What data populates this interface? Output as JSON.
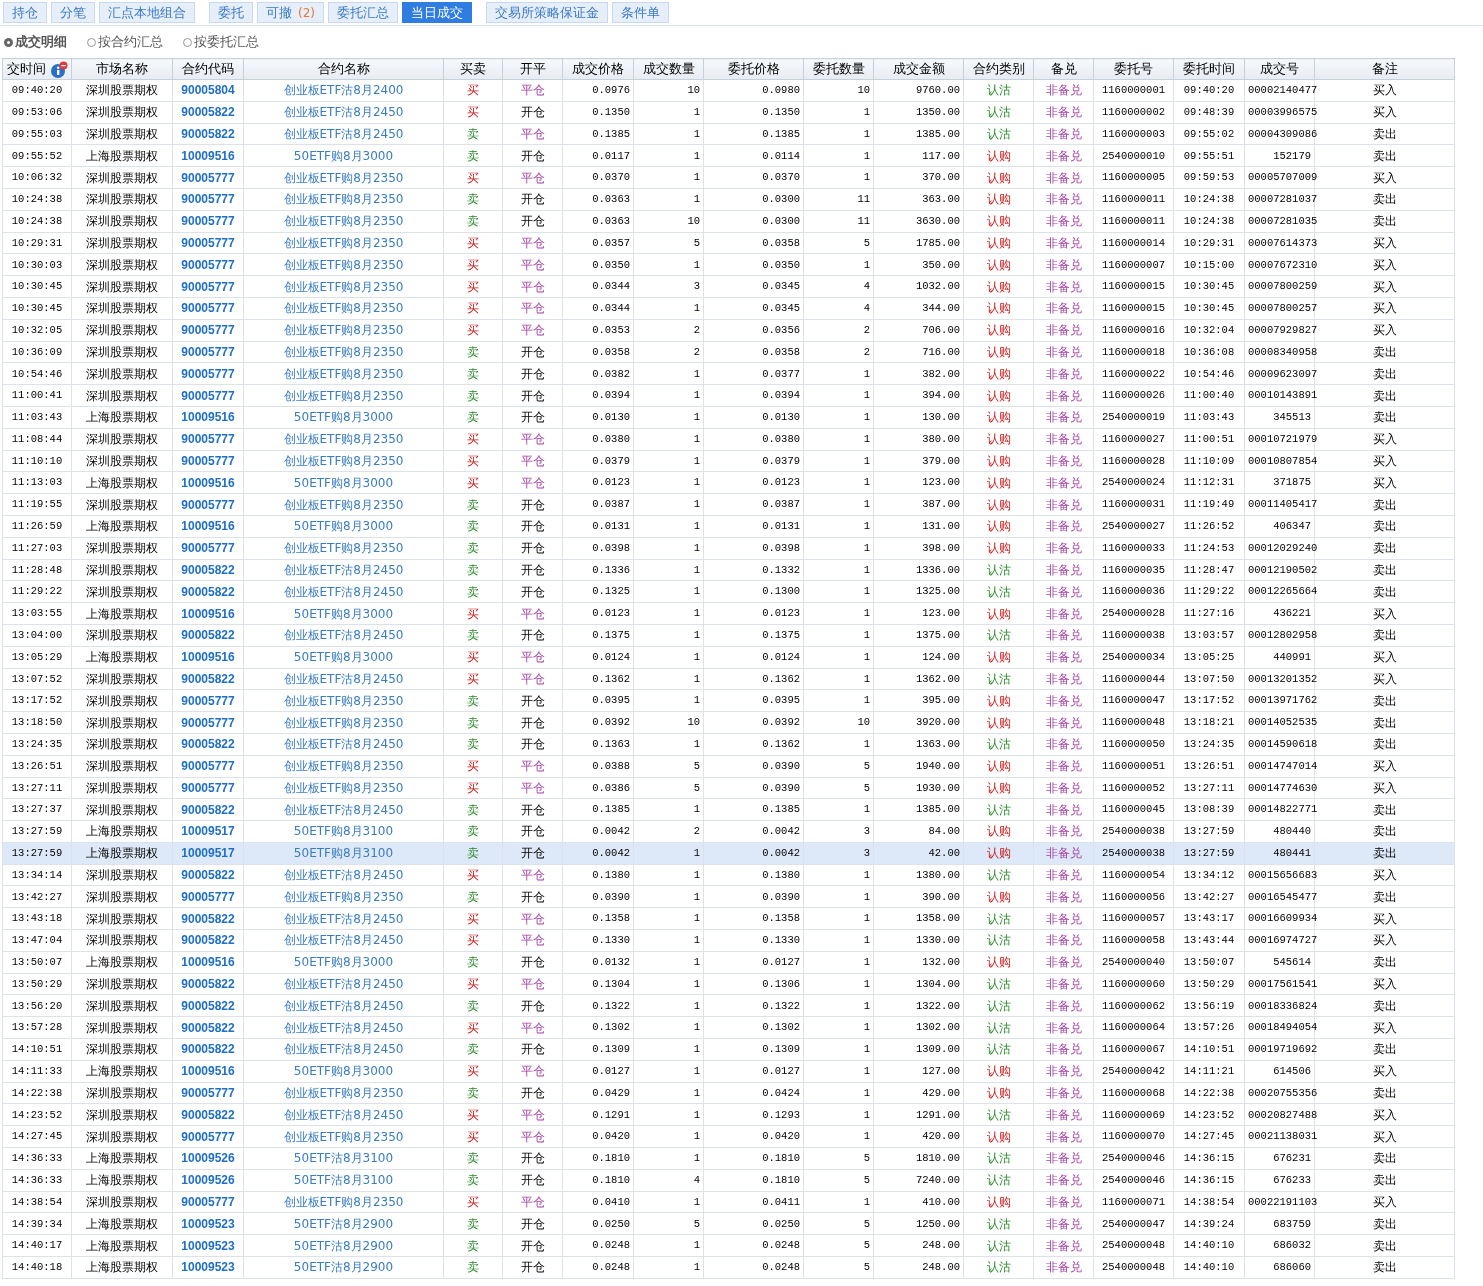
{
  "tab_groups": [
    [
      {
        "label": "持仓",
        "selected": false
      },
      {
        "label": "分笔",
        "selected": false
      },
      {
        "label": "汇点本地组合",
        "selected": false
      }
    ],
    [
      {
        "label": "委托",
        "selected": false
      },
      {
        "label": "可撤",
        "count": "(2)",
        "selected": false
      },
      {
        "label": "委托汇总",
        "selected": false
      },
      {
        "label": "当日成交",
        "selected": true
      }
    ],
    [
      {
        "label": "交易所策略保证金",
        "selected": false
      },
      {
        "label": "条件单",
        "selected": false
      }
    ]
  ],
  "view_options": [
    {
      "label": "成交明细",
      "selected": true
    },
    {
      "label": "按合约汇总",
      "selected": false
    },
    {
      "label": "按委托汇总",
      "selected": false
    }
  ],
  "table": {
    "columns": [
      "交时间",
      "市场名称",
      "合约代码",
      "合约名称",
      "买卖",
      "开平",
      "成交价格",
      "成交数量",
      "委托价格",
      "委托数量",
      "成交金额",
      "合约类别",
      "备兑",
      "委托号",
      "委托时间",
      "成交号",
      "备注"
    ],
    "rows": [
      {
        "selected": false,
        "cells": [
          "09:40:20",
          "深圳股票期权",
          "90005804",
          "创业板ETF沽8月2400",
          {
            "text": "买",
            "kind": "buy"
          },
          {
            "text": "平仓",
            "kind": "close"
          },
          "0.0976",
          "10",
          "0.0980",
          "10",
          "9760.00",
          {
            "text": "认沽",
            "kind": "put"
          },
          "非备兑",
          "1160000001",
          "09:40:20",
          "00002140477",
          "买入"
        ]
      },
      {
        "selected": false,
        "cells": [
          "09:53:06",
          "深圳股票期权",
          "90005822",
          "创业板ETF沽8月2450",
          {
            "text": "买",
            "kind": "buy"
          },
          {
            "text": "开仓",
            "kind": "open"
          },
          "0.1350",
          "1",
          "0.1350",
          "1",
          "1350.00",
          {
            "text": "认沽",
            "kind": "put"
          },
          "非备兑",
          "1160000002",
          "09:48:39",
          "00003996575",
          "买入"
        ]
      },
      {
        "selected": false,
        "cells": [
          "09:55:03",
          "深圳股票期权",
          "90005822",
          "创业板ETF沽8月2450",
          {
            "text": "卖",
            "kind": "sell"
          },
          {
            "text": "平仓",
            "kind": "close"
          },
          "0.1385",
          "1",
          "0.1385",
          "1",
          "1385.00",
          {
            "text": "认沽",
            "kind": "put"
          },
          "非备兑",
          "1160000003",
          "09:55:02",
          "00004309086",
          "卖出"
        ]
      },
      {
        "selected": false,
        "cells": [
          "09:55:52",
          "上海股票期权",
          "10009516",
          "50ETF购8月3000",
          {
            "text": "卖",
            "kind": "sell"
          },
          {
            "text": "开仓",
            "kind": "open"
          },
          "0.0117",
          "1",
          "0.0114",
          "1",
          "117.00",
          {
            "text": "认购",
            "kind": "call"
          },
          "非备兑",
          "2540000010",
          "09:55:51",
          "152179",
          "卖出"
        ]
      },
      {
        "selected": false,
        "cells": [
          "10:06:32",
          "深圳股票期权",
          "90005777",
          "创业板ETF购8月2350",
          {
            "text": "买",
            "kind": "buy"
          },
          {
            "text": "平仓",
            "kind": "close"
          },
          "0.0370",
          "1",
          "0.0370",
          "1",
          "370.00",
          {
            "text": "认购",
            "kind": "call"
          },
          "非备兑",
          "1160000005",
          "09:59:53",
          "00005707009",
          "买入"
        ]
      },
      {
        "selected": false,
        "cells": [
          "10:24:38",
          "深圳股票期权",
          "90005777",
          "创业板ETF购8月2350",
          {
            "text": "卖",
            "kind": "sell"
          },
          {
            "text": "开仓",
            "kind": "open"
          },
          "0.0363",
          "1",
          "0.0300",
          "11",
          "363.00",
          {
            "text": "认购",
            "kind": "call"
          },
          "非备兑",
          "1160000011",
          "10:24:38",
          "00007281037",
          "卖出"
        ]
      },
      {
        "selected": false,
        "cells": [
          "10:24:38",
          "深圳股票期权",
          "90005777",
          "创业板ETF购8月2350",
          {
            "text": "卖",
            "kind": "sell"
          },
          {
            "text": "开仓",
            "kind": "open"
          },
          "0.0363",
          "10",
          "0.0300",
          "11",
          "3630.00",
          {
            "text": "认购",
            "kind": "call"
          },
          "非备兑",
          "1160000011",
          "10:24:38",
          "00007281035",
          "卖出"
        ]
      },
      {
        "selected": false,
        "cells": [
          "10:29:31",
          "深圳股票期权",
          "90005777",
          "创业板ETF购8月2350",
          {
            "text": "买",
            "kind": "buy"
          },
          {
            "text": "平仓",
            "kind": "close"
          },
          "0.0357",
          "5",
          "0.0358",
          "5",
          "1785.00",
          {
            "text": "认购",
            "kind": "call"
          },
          "非备兑",
          "1160000014",
          "10:29:31",
          "00007614373",
          "买入"
        ]
      },
      {
        "selected": false,
        "cells": [
          "10:30:03",
          "深圳股票期权",
          "90005777",
          "创业板ETF购8月2350",
          {
            "text": "买",
            "kind": "buy"
          },
          {
            "text": "平仓",
            "kind": "close"
          },
          "0.0350",
          "1",
          "0.0350",
          "1",
          "350.00",
          {
            "text": "认购",
            "kind": "call"
          },
          "非备兑",
          "1160000007",
          "10:15:00",
          "00007672310",
          "买入"
        ]
      },
      {
        "selected": false,
        "cells": [
          "10:30:45",
          "深圳股票期权",
          "90005777",
          "创业板ETF购8月2350",
          {
            "text": "买",
            "kind": "buy"
          },
          {
            "text": "平仓",
            "kind": "close"
          },
          "0.0344",
          "3",
          "0.0345",
          "4",
          "1032.00",
          {
            "text": "认购",
            "kind": "call"
          },
          "非备兑",
          "1160000015",
          "10:30:45",
          "00007800259",
          "买入"
        ]
      },
      {
        "selected": false,
        "cells": [
          "10:30:45",
          "深圳股票期权",
          "90005777",
          "创业板ETF购8月2350",
          {
            "text": "买",
            "kind": "buy"
          },
          {
            "text": "平仓",
            "kind": "close"
          },
          "0.0344",
          "1",
          "0.0345",
          "4",
          "344.00",
          {
            "text": "认购",
            "kind": "call"
          },
          "非备兑",
          "1160000015",
          "10:30:45",
          "00007800257",
          "买入"
        ]
      },
      {
        "selected": false,
        "cells": [
          "10:32:05",
          "深圳股票期权",
          "90005777",
          "创业板ETF购8月2350",
          {
            "text": "买",
            "kind": "buy"
          },
          {
            "text": "平仓",
            "kind": "close"
          },
          "0.0353",
          "2",
          "0.0356",
          "2",
          "706.00",
          {
            "text": "认购",
            "kind": "call"
          },
          "非备兑",
          "1160000016",
          "10:32:04",
          "00007929827",
          "买入"
        ]
      },
      {
        "selected": false,
        "cells": [
          "10:36:09",
          "深圳股票期权",
          "90005777",
          "创业板ETF购8月2350",
          {
            "text": "卖",
            "kind": "sell"
          },
          {
            "text": "开仓",
            "kind": "open"
          },
          "0.0358",
          "2",
          "0.0358",
          "2",
          "716.00",
          {
            "text": "认购",
            "kind": "call"
          },
          "非备兑",
          "1160000018",
          "10:36:08",
          "00008340958",
          "卖出"
        ]
      },
      {
        "selected": false,
        "cells": [
          "10:54:46",
          "深圳股票期权",
          "90005777",
          "创业板ETF购8月2350",
          {
            "text": "卖",
            "kind": "sell"
          },
          {
            "text": "开仓",
            "kind": "open"
          },
          "0.0382",
          "1",
          "0.0377",
          "1",
          "382.00",
          {
            "text": "认购",
            "kind": "call"
          },
          "非备兑",
          "1160000022",
          "10:54:46",
          "00009623097",
          "卖出"
        ]
      },
      {
        "selected": false,
        "cells": [
          "11:00:41",
          "深圳股票期权",
          "90005777",
          "创业板ETF购8月2350",
          {
            "text": "卖",
            "kind": "sell"
          },
          {
            "text": "开仓",
            "kind": "open"
          },
          "0.0394",
          "1",
          "0.0394",
          "1",
          "394.00",
          {
            "text": "认购",
            "kind": "call"
          },
          "非备兑",
          "1160000026",
          "11:00:40",
          "00010143891",
          "卖出"
        ]
      },
      {
        "selected": false,
        "cells": [
          "11:03:43",
          "上海股票期权",
          "10009516",
          "50ETF购8月3000",
          {
            "text": "卖",
            "kind": "sell"
          },
          {
            "text": "开仓",
            "kind": "open"
          },
          "0.0130",
          "1",
          "0.0130",
          "1",
          "130.00",
          {
            "text": "认购",
            "kind": "call"
          },
          "非备兑",
          "2540000019",
          "11:03:43",
          "345513",
          "卖出"
        ]
      },
      {
        "selected": false,
        "cells": [
          "11:08:44",
          "深圳股票期权",
          "90005777",
          "创业板ETF购8月2350",
          {
            "text": "买",
            "kind": "buy"
          },
          {
            "text": "平仓",
            "kind": "close"
          },
          "0.0380",
          "1",
          "0.0380",
          "1",
          "380.00",
          {
            "text": "认购",
            "kind": "call"
          },
          "非备兑",
          "1160000027",
          "11:00:51",
          "00010721979",
          "买入"
        ]
      },
      {
        "selected": false,
        "cells": [
          "11:10:10",
          "深圳股票期权",
          "90005777",
          "创业板ETF购8月2350",
          {
            "text": "买",
            "kind": "buy"
          },
          {
            "text": "平仓",
            "kind": "close"
          },
          "0.0379",
          "1",
          "0.0379",
          "1",
          "379.00",
          {
            "text": "认购",
            "kind": "call"
          },
          "非备兑",
          "1160000028",
          "11:10:09",
          "00010807854",
          "买入"
        ]
      },
      {
        "selected": false,
        "cells": [
          "11:13:03",
          "上海股票期权",
          "10009516",
          "50ETF购8月3000",
          {
            "text": "买",
            "kind": "buy"
          },
          {
            "text": "平仓",
            "kind": "close"
          },
          "0.0123",
          "1",
          "0.0123",
          "1",
          "123.00",
          {
            "text": "认购",
            "kind": "call"
          },
          "非备兑",
          "2540000024",
          "11:12:31",
          "371875",
          "买入"
        ]
      },
      {
        "selected": false,
        "cells": [
          "11:19:55",
          "深圳股票期权",
          "90005777",
          "创业板ETF购8月2350",
          {
            "text": "卖",
            "kind": "sell"
          },
          {
            "text": "开仓",
            "kind": "open"
          },
          "0.0387",
          "1",
          "0.0387",
          "1",
          "387.00",
          {
            "text": "认购",
            "kind": "call"
          },
          "非备兑",
          "1160000031",
          "11:19:49",
          "00011405417",
          "卖出"
        ]
      },
      {
        "selected": false,
        "cells": [
          "11:26:59",
          "上海股票期权",
          "10009516",
          "50ETF购8月3000",
          {
            "text": "卖",
            "kind": "sell"
          },
          {
            "text": "开仓",
            "kind": "open"
          },
          "0.0131",
          "1",
          "0.0131",
          "1",
          "131.00",
          {
            "text": "认购",
            "kind": "call"
          },
          "非备兑",
          "2540000027",
          "11:26:52",
          "406347",
          "卖出"
        ]
      },
      {
        "selected": false,
        "cells": [
          "11:27:03",
          "深圳股票期权",
          "90005777",
          "创业板ETF购8月2350",
          {
            "text": "卖",
            "kind": "sell"
          },
          {
            "text": "开仓",
            "kind": "open"
          },
          "0.0398",
          "1",
          "0.0398",
          "1",
          "398.00",
          {
            "text": "认购",
            "kind": "call"
          },
          "非备兑",
          "1160000033",
          "11:24:53",
          "00012029240",
          "卖出"
        ]
      },
      {
        "selected": false,
        "cells": [
          "11:28:48",
          "深圳股票期权",
          "90005822",
          "创业板ETF沽8月2450",
          {
            "text": "卖",
            "kind": "sell"
          },
          {
            "text": "开仓",
            "kind": "open"
          },
          "0.1336",
          "1",
          "0.1332",
          "1",
          "1336.00",
          {
            "text": "认沽",
            "kind": "put"
          },
          "非备兑",
          "1160000035",
          "11:28:47",
          "00012190502",
          "卖出"
        ]
      },
      {
        "selected": false,
        "cells": [
          "11:29:22",
          "深圳股票期权",
          "90005822",
          "创业板ETF沽8月2450",
          {
            "text": "卖",
            "kind": "sell"
          },
          {
            "text": "开仓",
            "kind": "open"
          },
          "0.1325",
          "1",
          "0.1300",
          "1",
          "1325.00",
          {
            "text": "认沽",
            "kind": "put"
          },
          "非备兑",
          "1160000036",
          "11:29:22",
          "00012265664",
          "卖出"
        ]
      },
      {
        "selected": false,
        "cells": [
          "13:03:55",
          "上海股票期权",
          "10009516",
          "50ETF购8月3000",
          {
            "text": "买",
            "kind": "buy"
          },
          {
            "text": "平仓",
            "kind": "close"
          },
          "0.0123",
          "1",
          "0.0123",
          "1",
          "123.00",
          {
            "text": "认购",
            "kind": "call"
          },
          "非备兑",
          "2540000028",
          "11:27:16",
          "436221",
          "买入"
        ]
      },
      {
        "selected": false,
        "cells": [
          "13:04:00",
          "深圳股票期权",
          "90005822",
          "创业板ETF沽8月2450",
          {
            "text": "卖",
            "kind": "sell"
          },
          {
            "text": "开仓",
            "kind": "open"
          },
          "0.1375",
          "1",
          "0.1375",
          "1",
          "1375.00",
          {
            "text": "认沽",
            "kind": "put"
          },
          "非备兑",
          "1160000038",
          "13:03:57",
          "00012802958",
          "卖出"
        ]
      },
      {
        "selected": false,
        "cells": [
          "13:05:29",
          "上海股票期权",
          "10009516",
          "50ETF购8月3000",
          {
            "text": "买",
            "kind": "buy"
          },
          {
            "text": "平仓",
            "kind": "close"
          },
          "0.0124",
          "1",
          "0.0124",
          "1",
          "124.00",
          {
            "text": "认购",
            "kind": "call"
          },
          "非备兑",
          "2540000034",
          "13:05:25",
          "440991",
          "买入"
        ]
      },
      {
        "selected": false,
        "cells": [
          "13:07:52",
          "深圳股票期权",
          "90005822",
          "创业板ETF沽8月2450",
          {
            "text": "买",
            "kind": "buy"
          },
          {
            "text": "平仓",
            "kind": "close"
          },
          "0.1362",
          "1",
          "0.1362",
          "1",
          "1362.00",
          {
            "text": "认沽",
            "kind": "put"
          },
          "非备兑",
          "1160000044",
          "13:07:50",
          "00013201352",
          "买入"
        ]
      },
      {
        "selected": false,
        "cells": [
          "13:17:52",
          "深圳股票期权",
          "90005777",
          "创业板ETF购8月2350",
          {
            "text": "卖",
            "kind": "sell"
          },
          {
            "text": "开仓",
            "kind": "open"
          },
          "0.0395",
          "1",
          "0.0395",
          "1",
          "395.00",
          {
            "text": "认购",
            "kind": "call"
          },
          "非备兑",
          "1160000047",
          "13:17:52",
          "00013971762",
          "卖出"
        ]
      },
      {
        "selected": false,
        "cells": [
          "13:18:50",
          "深圳股票期权",
          "90005777",
          "创业板ETF购8月2350",
          {
            "text": "卖",
            "kind": "sell"
          },
          {
            "text": "开仓",
            "kind": "open"
          },
          "0.0392",
          "10",
          "0.0392",
          "10",
          "3920.00",
          {
            "text": "认购",
            "kind": "call"
          },
          "非备兑",
          "1160000048",
          "13:18:21",
          "00014052535",
          "卖出"
        ]
      },
      {
        "selected": false,
        "cells": [
          "13:24:35",
          "深圳股票期权",
          "90005822",
          "创业板ETF沽8月2450",
          {
            "text": "卖",
            "kind": "sell"
          },
          {
            "text": "开仓",
            "kind": "open"
          },
          "0.1363",
          "1",
          "0.1362",
          "1",
          "1363.00",
          {
            "text": "认沽",
            "kind": "put"
          },
          "非备兑",
          "1160000050",
          "13:24:35",
          "00014590618",
          "卖出"
        ]
      },
      {
        "selected": false,
        "cells": [
          "13:26:51",
          "深圳股票期权",
          "90005777",
          "创业板ETF购8月2350",
          {
            "text": "买",
            "kind": "buy"
          },
          {
            "text": "平仓",
            "kind": "close"
          },
          "0.0388",
          "5",
          "0.0390",
          "5",
          "1940.00",
          {
            "text": "认购",
            "kind": "call"
          },
          "非备兑",
          "1160000051",
          "13:26:51",
          "00014747014",
          "买入"
        ]
      },
      {
        "selected": false,
        "cells": [
          "13:27:11",
          "深圳股票期权",
          "90005777",
          "创业板ETF购8月2350",
          {
            "text": "买",
            "kind": "buy"
          },
          {
            "text": "平仓",
            "kind": "close"
          },
          "0.0386",
          "5",
          "0.0390",
          "5",
          "1930.00",
          {
            "text": "认购",
            "kind": "call"
          },
          "非备兑",
          "1160000052",
          "13:27:11",
          "00014774630",
          "买入"
        ]
      },
      {
        "selected": false,
        "cells": [
          "13:27:37",
          "深圳股票期权",
          "90005822",
          "创业板ETF沽8月2450",
          {
            "text": "卖",
            "kind": "sell"
          },
          {
            "text": "开仓",
            "kind": "open"
          },
          "0.1385",
          "1",
          "0.1385",
          "1",
          "1385.00",
          {
            "text": "认沽",
            "kind": "put"
          },
          "非备兑",
          "1160000045",
          "13:08:39",
          "00014822771",
          "卖出"
        ]
      },
      {
        "selected": false,
        "cells": [
          "13:27:59",
          "上海股票期权",
          "10009517",
          "50ETF购8月3100",
          {
            "text": "卖",
            "kind": "sell"
          },
          {
            "text": "开仓",
            "kind": "open"
          },
          "0.0042",
          "2",
          "0.0042",
          "3",
          "84.00",
          {
            "text": "认购",
            "kind": "call"
          },
          "非备兑",
          "2540000038",
          "13:27:59",
          "480440",
          "卖出"
        ]
      },
      {
        "selected": true,
        "cells": [
          "13:27:59",
          "上海股票期权",
          "10009517",
          "50ETF购8月3100",
          {
            "text": "卖",
            "kind": "sell"
          },
          {
            "text": "开仓",
            "kind": "open"
          },
          "0.0042",
          "1",
          "0.0042",
          "3",
          "42.00",
          {
            "text": "认购",
            "kind": "call"
          },
          "非备兑",
          "2540000038",
          "13:27:59",
          "480441",
          "卖出"
        ]
      },
      {
        "selected": false,
        "cells": [
          "13:34:14",
          "深圳股票期权",
          "90005822",
          "创业板ETF沽8月2450",
          {
            "text": "买",
            "kind": "buy"
          },
          {
            "text": "平仓",
            "kind": "close"
          },
          "0.1380",
          "1",
          "0.1380",
          "1",
          "1380.00",
          {
            "text": "认沽",
            "kind": "put"
          },
          "非备兑",
          "1160000054",
          "13:34:12",
          "00015656683",
          "买入"
        ]
      },
      {
        "selected": false,
        "cells": [
          "13:42:27",
          "深圳股票期权",
          "90005777",
          "创业板ETF购8月2350",
          {
            "text": "卖",
            "kind": "sell"
          },
          {
            "text": "开仓",
            "kind": "open"
          },
          "0.0390",
          "1",
          "0.0390",
          "1",
          "390.00",
          {
            "text": "认购",
            "kind": "call"
          },
          "非备兑",
          "1160000056",
          "13:42:27",
          "00016545477",
          "卖出"
        ]
      },
      {
        "selected": false,
        "cells": [
          "13:43:18",
          "深圳股票期权",
          "90005822",
          "创业板ETF沽8月2450",
          {
            "text": "买",
            "kind": "buy"
          },
          {
            "text": "平仓",
            "kind": "close"
          },
          "0.1358",
          "1",
          "0.1358",
          "1",
          "1358.00",
          {
            "text": "认沽",
            "kind": "put"
          },
          "非备兑",
          "1160000057",
          "13:43:17",
          "00016609934",
          "买入"
        ]
      },
      {
        "selected": false,
        "cells": [
          "13:47:04",
          "深圳股票期权",
          "90005822",
          "创业板ETF沽8月2450",
          {
            "text": "买",
            "kind": "buy"
          },
          {
            "text": "平仓",
            "kind": "close"
          },
          "0.1330",
          "1",
          "0.1330",
          "1",
          "1330.00",
          {
            "text": "认沽",
            "kind": "put"
          },
          "非备兑",
          "1160000058",
          "13:43:44",
          "00016974727",
          "买入"
        ]
      },
      {
        "selected": false,
        "cells": [
          "13:50:07",
          "上海股票期权",
          "10009516",
          "50ETF购8月3000",
          {
            "text": "卖",
            "kind": "sell"
          },
          {
            "text": "开仓",
            "kind": "open"
          },
          "0.0132",
          "1",
          "0.0127",
          "1",
          "132.00",
          {
            "text": "认购",
            "kind": "call"
          },
          "非备兑",
          "2540000040",
          "13:50:07",
          "545614",
          "卖出"
        ]
      },
      {
        "selected": false,
        "cells": [
          "13:50:29",
          "深圳股票期权",
          "90005822",
          "创业板ETF沽8月2450",
          {
            "text": "买",
            "kind": "buy"
          },
          {
            "text": "平仓",
            "kind": "close"
          },
          "0.1304",
          "1",
          "0.1306",
          "1",
          "1304.00",
          {
            "text": "认沽",
            "kind": "put"
          },
          "非备兑",
          "1160000060",
          "13:50:29",
          "00017561541",
          "买入"
        ]
      },
      {
        "selected": false,
        "cells": [
          "13:56:20",
          "深圳股票期权",
          "90005822",
          "创业板ETF沽8月2450",
          {
            "text": "卖",
            "kind": "sell"
          },
          {
            "text": "开仓",
            "kind": "open"
          },
          "0.1322",
          "1",
          "0.1322",
          "1",
          "1322.00",
          {
            "text": "认沽",
            "kind": "put"
          },
          "非备兑",
          "1160000062",
          "13:56:19",
          "00018336824",
          "卖出"
        ]
      },
      {
        "selected": false,
        "cells": [
          "13:57:28",
          "深圳股票期权",
          "90005822",
          "创业板ETF沽8月2450",
          {
            "text": "买",
            "kind": "buy"
          },
          {
            "text": "平仓",
            "kind": "close"
          },
          "0.1302",
          "1",
          "0.1302",
          "1",
          "1302.00",
          {
            "text": "认沽",
            "kind": "put"
          },
          "非备兑",
          "1160000064",
          "13:57:26",
          "00018494054",
          "买入"
        ]
      },
      {
        "selected": false,
        "cells": [
          "14:10:51",
          "深圳股票期权",
          "90005822",
          "创业板ETF沽8月2450",
          {
            "text": "卖",
            "kind": "sell"
          },
          {
            "text": "开仓",
            "kind": "open"
          },
          "0.1309",
          "1",
          "0.1309",
          "1",
          "1309.00",
          {
            "text": "认沽",
            "kind": "put"
          },
          "非备兑",
          "1160000067",
          "14:10:51",
          "00019719692",
          "卖出"
        ]
      },
      {
        "selected": false,
        "cells": [
          "14:11:33",
          "上海股票期权",
          "10009516",
          "50ETF购8月3000",
          {
            "text": "买",
            "kind": "buy"
          },
          {
            "text": "平仓",
            "kind": "close"
          },
          "0.0127",
          "1",
          "0.0127",
          "1",
          "127.00",
          {
            "text": "认购",
            "kind": "call"
          },
          "非备兑",
          "2540000042",
          "14:11:21",
          "614506",
          "买入"
        ]
      },
      {
        "selected": false,
        "cells": [
          "14:22:38",
          "深圳股票期权",
          "90005777",
          "创业板ETF购8月2350",
          {
            "text": "卖",
            "kind": "sell"
          },
          {
            "text": "开仓",
            "kind": "open"
          },
          "0.0429",
          "1",
          "0.0424",
          "1",
          "429.00",
          {
            "text": "认购",
            "kind": "call"
          },
          "非备兑",
          "1160000068",
          "14:22:38",
          "00020755356",
          "卖出"
        ]
      },
      {
        "selected": false,
        "cells": [
          "14:23:52",
          "深圳股票期权",
          "90005822",
          "创业板ETF沽8月2450",
          {
            "text": "买",
            "kind": "buy"
          },
          {
            "text": "平仓",
            "kind": "close"
          },
          "0.1291",
          "1",
          "0.1293",
          "1",
          "1291.00",
          {
            "text": "认沽",
            "kind": "put"
          },
          "非备兑",
          "1160000069",
          "14:23:52",
          "00020827488",
          "买入"
        ]
      },
      {
        "selected": false,
        "cells": [
          "14:27:45",
          "深圳股票期权",
          "90005777",
          "创业板ETF购8月2350",
          {
            "text": "买",
            "kind": "buy"
          },
          {
            "text": "平仓",
            "kind": "close"
          },
          "0.0420",
          "1",
          "0.0420",
          "1",
          "420.00",
          {
            "text": "认购",
            "kind": "call"
          },
          "非备兑",
          "1160000070",
          "14:27:45",
          "00021138031",
          "买入"
        ]
      },
      {
        "selected": false,
        "cells": [
          "14:36:33",
          "上海股票期权",
          "10009526",
          "50ETF沽8月3100",
          {
            "text": "卖",
            "kind": "sell"
          },
          {
            "text": "开仓",
            "kind": "open"
          },
          "0.1810",
          "1",
          "0.1810",
          "5",
          "1810.00",
          {
            "text": "认沽",
            "kind": "put"
          },
          "非备兑",
          "2540000046",
          "14:36:15",
          "676231",
          "卖出"
        ]
      },
      {
        "selected": false,
        "cells": [
          "14:36:33",
          "上海股票期权",
          "10009526",
          "50ETF沽8月3100",
          {
            "text": "卖",
            "kind": "sell"
          },
          {
            "text": "开仓",
            "kind": "open"
          },
          "0.1810",
          "4",
          "0.1810",
          "5",
          "7240.00",
          {
            "text": "认沽",
            "kind": "put"
          },
          "非备兑",
          "2540000046",
          "14:36:15",
          "676233",
          "卖出"
        ]
      },
      {
        "selected": false,
        "cells": [
          "14:38:54",
          "深圳股票期权",
          "90005777",
          "创业板ETF购8月2350",
          {
            "text": "买",
            "kind": "buy"
          },
          {
            "text": "平仓",
            "kind": "close"
          },
          "0.0410",
          "1",
          "0.0411",
          "1",
          "410.00",
          {
            "text": "认购",
            "kind": "call"
          },
          "非备兑",
          "1160000071",
          "14:38:54",
          "00022191103",
          "买入"
        ]
      },
      {
        "selected": false,
        "cells": [
          "14:39:34",
          "上海股票期权",
          "10009523",
          "50ETF沽8月2900",
          {
            "text": "卖",
            "kind": "sell"
          },
          {
            "text": "开仓",
            "kind": "open"
          },
          "0.0250",
          "5",
          "0.0250",
          "5",
          "1250.00",
          {
            "text": "认沽",
            "kind": "put"
          },
          "非备兑",
          "2540000047",
          "14:39:24",
          "683759",
          "卖出"
        ]
      },
      {
        "selected": false,
        "cells": [
          "14:40:17",
          "上海股票期权",
          "10009523",
          "50ETF沽8月2900",
          {
            "text": "卖",
            "kind": "sell"
          },
          {
            "text": "开仓",
            "kind": "open"
          },
          "0.0248",
          "1",
          "0.0248",
          "5",
          "248.00",
          {
            "text": "认沽",
            "kind": "put"
          },
          "非备兑",
          "2540000048",
          "14:40:10",
          "686032",
          "卖出"
        ]
      },
      {
        "selected": false,
        "cells": [
          "14:40:18",
          "上海股票期权",
          "10009523",
          "50ETF沽8月2900",
          {
            "text": "卖",
            "kind": "sell"
          },
          {
            "text": "开仓",
            "kind": "open"
          },
          "0.0248",
          "1",
          "0.0248",
          "5",
          "248.00",
          {
            "text": "认沽",
            "kind": "put"
          },
          "非备兑",
          "2540000048",
          "14:40:10",
          "686060",
          "卖出"
        ]
      }
    ]
  }
}
